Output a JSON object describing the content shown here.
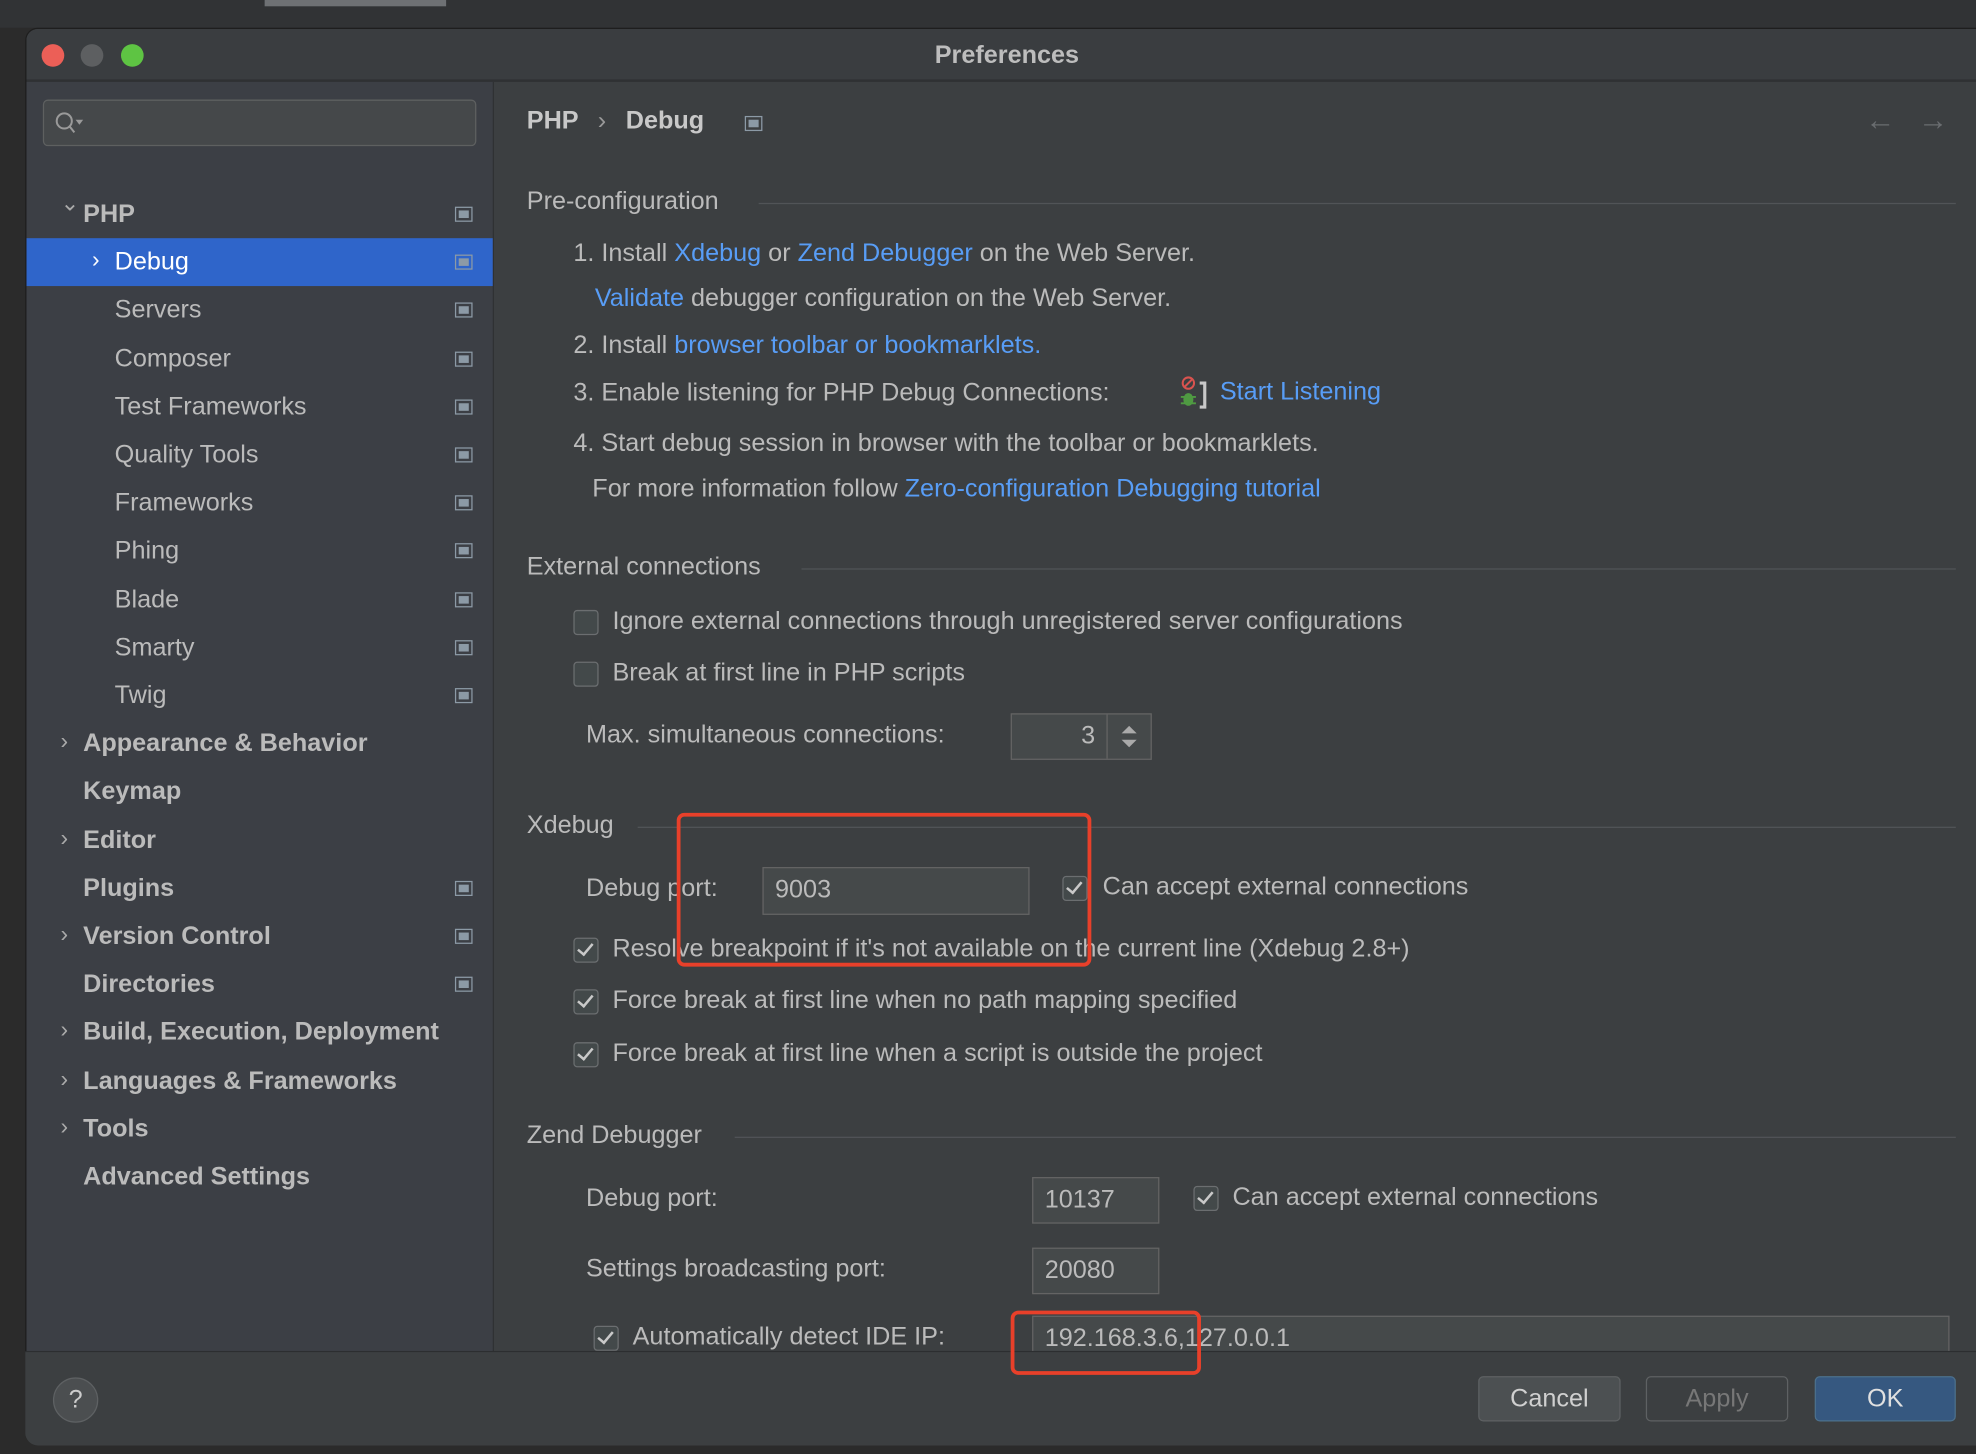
{
  "window": {
    "title": "Preferences"
  },
  "search": {
    "placeholder": ""
  },
  "sidebar": {
    "items": [
      {
        "label": "PHP",
        "level": 0,
        "bold": true,
        "arrow": "down",
        "settings_icon": true
      },
      {
        "label": "Debug",
        "level": 1,
        "bold": false,
        "arrow": "right",
        "settings_icon": true,
        "selected": true
      },
      {
        "label": "Servers",
        "level": 1,
        "bold": false,
        "arrow": "",
        "settings_icon": true
      },
      {
        "label": "Composer",
        "level": 1,
        "bold": false,
        "arrow": "",
        "settings_icon": true
      },
      {
        "label": "Test Frameworks",
        "level": 1,
        "bold": false,
        "arrow": "",
        "settings_icon": true
      },
      {
        "label": "Quality Tools",
        "level": 1,
        "bold": false,
        "arrow": "",
        "settings_icon": true
      },
      {
        "label": "Frameworks",
        "level": 1,
        "bold": false,
        "arrow": "",
        "settings_icon": true
      },
      {
        "label": "Phing",
        "level": 1,
        "bold": false,
        "arrow": "",
        "settings_icon": true
      },
      {
        "label": "Blade",
        "level": 1,
        "bold": false,
        "arrow": "",
        "settings_icon": true
      },
      {
        "label": "Smarty",
        "level": 1,
        "bold": false,
        "arrow": "",
        "settings_icon": true
      },
      {
        "label": "Twig",
        "level": 1,
        "bold": false,
        "arrow": "",
        "settings_icon": true
      },
      {
        "label": "Appearance & Behavior",
        "level": 0,
        "bold": true,
        "arrow": "right",
        "settings_icon": false
      },
      {
        "label": "Keymap",
        "level": 0,
        "bold": true,
        "arrow": "",
        "settings_icon": false
      },
      {
        "label": "Editor",
        "level": 0,
        "bold": true,
        "arrow": "right",
        "settings_icon": false
      },
      {
        "label": "Plugins",
        "level": 0,
        "bold": true,
        "arrow": "",
        "settings_icon": true
      },
      {
        "label": "Version Control",
        "level": 0,
        "bold": true,
        "arrow": "right",
        "settings_icon": true
      },
      {
        "label": "Directories",
        "level": 0,
        "bold": true,
        "arrow": "",
        "settings_icon": true
      },
      {
        "label": "Build, Execution, Deployment",
        "level": 0,
        "bold": true,
        "arrow": "right",
        "settings_icon": false
      },
      {
        "label": "Languages & Frameworks",
        "level": 0,
        "bold": true,
        "arrow": "right",
        "settings_icon": false
      },
      {
        "label": "Tools",
        "level": 0,
        "bold": true,
        "arrow": "right",
        "settings_icon": false
      },
      {
        "label": "Advanced Settings",
        "level": 0,
        "bold": true,
        "arrow": "",
        "settings_icon": false
      }
    ]
  },
  "breadcrumb": {
    "parent": "PHP",
    "separator": "›",
    "current": "Debug"
  },
  "preconfig": {
    "title": "Pre-configuration",
    "step1_prefix": "1. Install ",
    "step1_link1": "Xdebug",
    "step1_mid": " or ",
    "step1_link2": "Zend Debugger",
    "step1_suffix": " on the Web Server.",
    "validate_link": "Validate",
    "validate_suffix": " debugger configuration on the Web Server.",
    "step2_prefix": "2. Install ",
    "step2_link": "browser toolbar or bookmarklets.",
    "step3_text": "3. Enable listening for PHP Debug Connections:",
    "step3_link": "Start Listening",
    "step4_text": "4. Start debug session in browser with the toolbar or bookmarklets.",
    "more_prefix": "For more information follow ",
    "more_link": "Zero-configuration Debugging tutorial"
  },
  "external": {
    "title": "External connections",
    "ignore_label": "Ignore external connections through unregistered server configurations",
    "ignore_checked": false,
    "break_label": "Break at first line in PHP scripts",
    "break_checked": false,
    "max_label": "Max. simultaneous connections:",
    "max_value": "3"
  },
  "xdebug": {
    "title": "Xdebug",
    "port_label": "Debug port:",
    "port_value": "9003",
    "accept_label": "Can accept external connections",
    "accept_checked": true,
    "resolve_label": "Resolve breakpoint if it's not available on the current line (Xdebug 2.8+)",
    "force_mapping_label": "Force break at first line when no path mapping specified",
    "force_outside_label": "Force break at first line when a script is outside the project"
  },
  "zend": {
    "title": "Zend Debugger",
    "port_label": "Debug port:",
    "port_value": "10137",
    "accept_label": "Can accept external connections",
    "broadcast_label": "Settings broadcasting port:",
    "broadcast_value": "20080",
    "detect_label": "Automatically detect IDE IP:",
    "ip_value": "192.168.3.6,127.0.0.1"
  },
  "footer": {
    "help": "?",
    "cancel": "Cancel",
    "apply": "Apply",
    "ok": "OK"
  },
  "colors": {
    "accent": "#2f65ca",
    "link": "#589df6",
    "ok_button": "#365880",
    "highlight": "#e8402a"
  }
}
